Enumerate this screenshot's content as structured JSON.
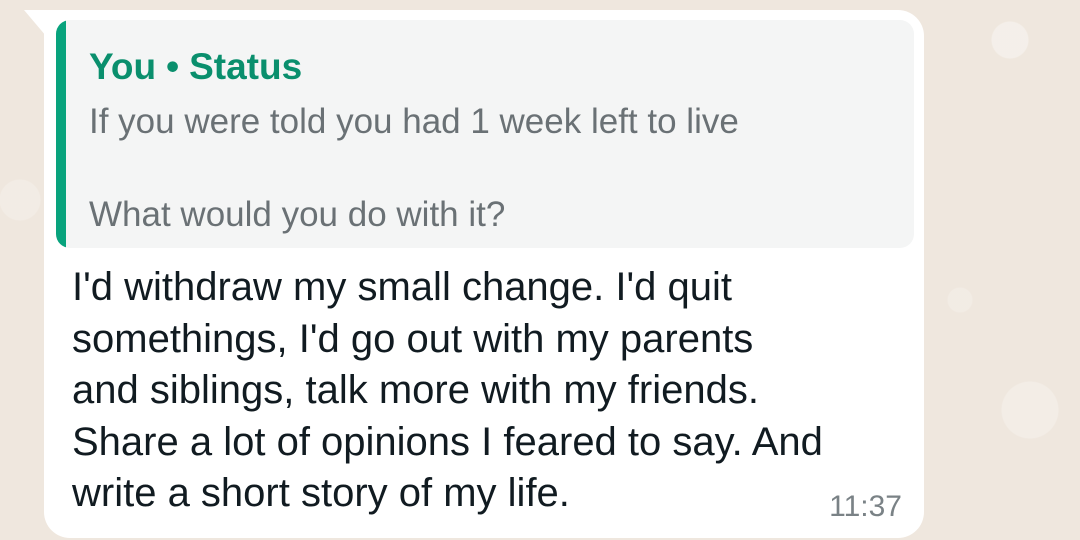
{
  "reply_quote": {
    "sender": "You",
    "separator": "•",
    "context": "Status",
    "lines": [
      "If you were told you had 1 week left to live",
      "What would you do with it?"
    ]
  },
  "message": {
    "lines": [
      "I'd withdraw my small change. I'd quit",
      "somethings, I'd go out with my parents",
      "and siblings, talk more with my friends.",
      "Share a lot of opinions I feared to say. And",
      "write a short story of my life."
    ],
    "time": "11:37"
  },
  "colors": {
    "accent": "#08a37d",
    "quote_header": "#0a8f6d",
    "wallpaper": "#efe7de",
    "bubble": "#ffffff"
  }
}
